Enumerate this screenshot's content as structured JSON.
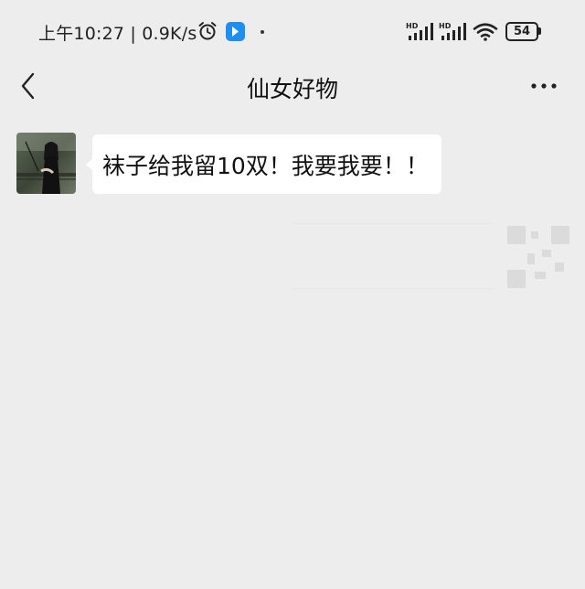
{
  "status_bar": {
    "time_speed": "上午10:27 | 0.9K/s",
    "network_1": "HD",
    "network_2": "HD",
    "battery_level": "54"
  },
  "nav": {
    "title": "仙女好物"
  },
  "messages": [
    {
      "text": "袜子给我留10双！我要我要！！"
    }
  ],
  "colors": {
    "background": "#ededed",
    "bubble": "#ffffff",
    "app_icon": "#1e8ef0"
  }
}
